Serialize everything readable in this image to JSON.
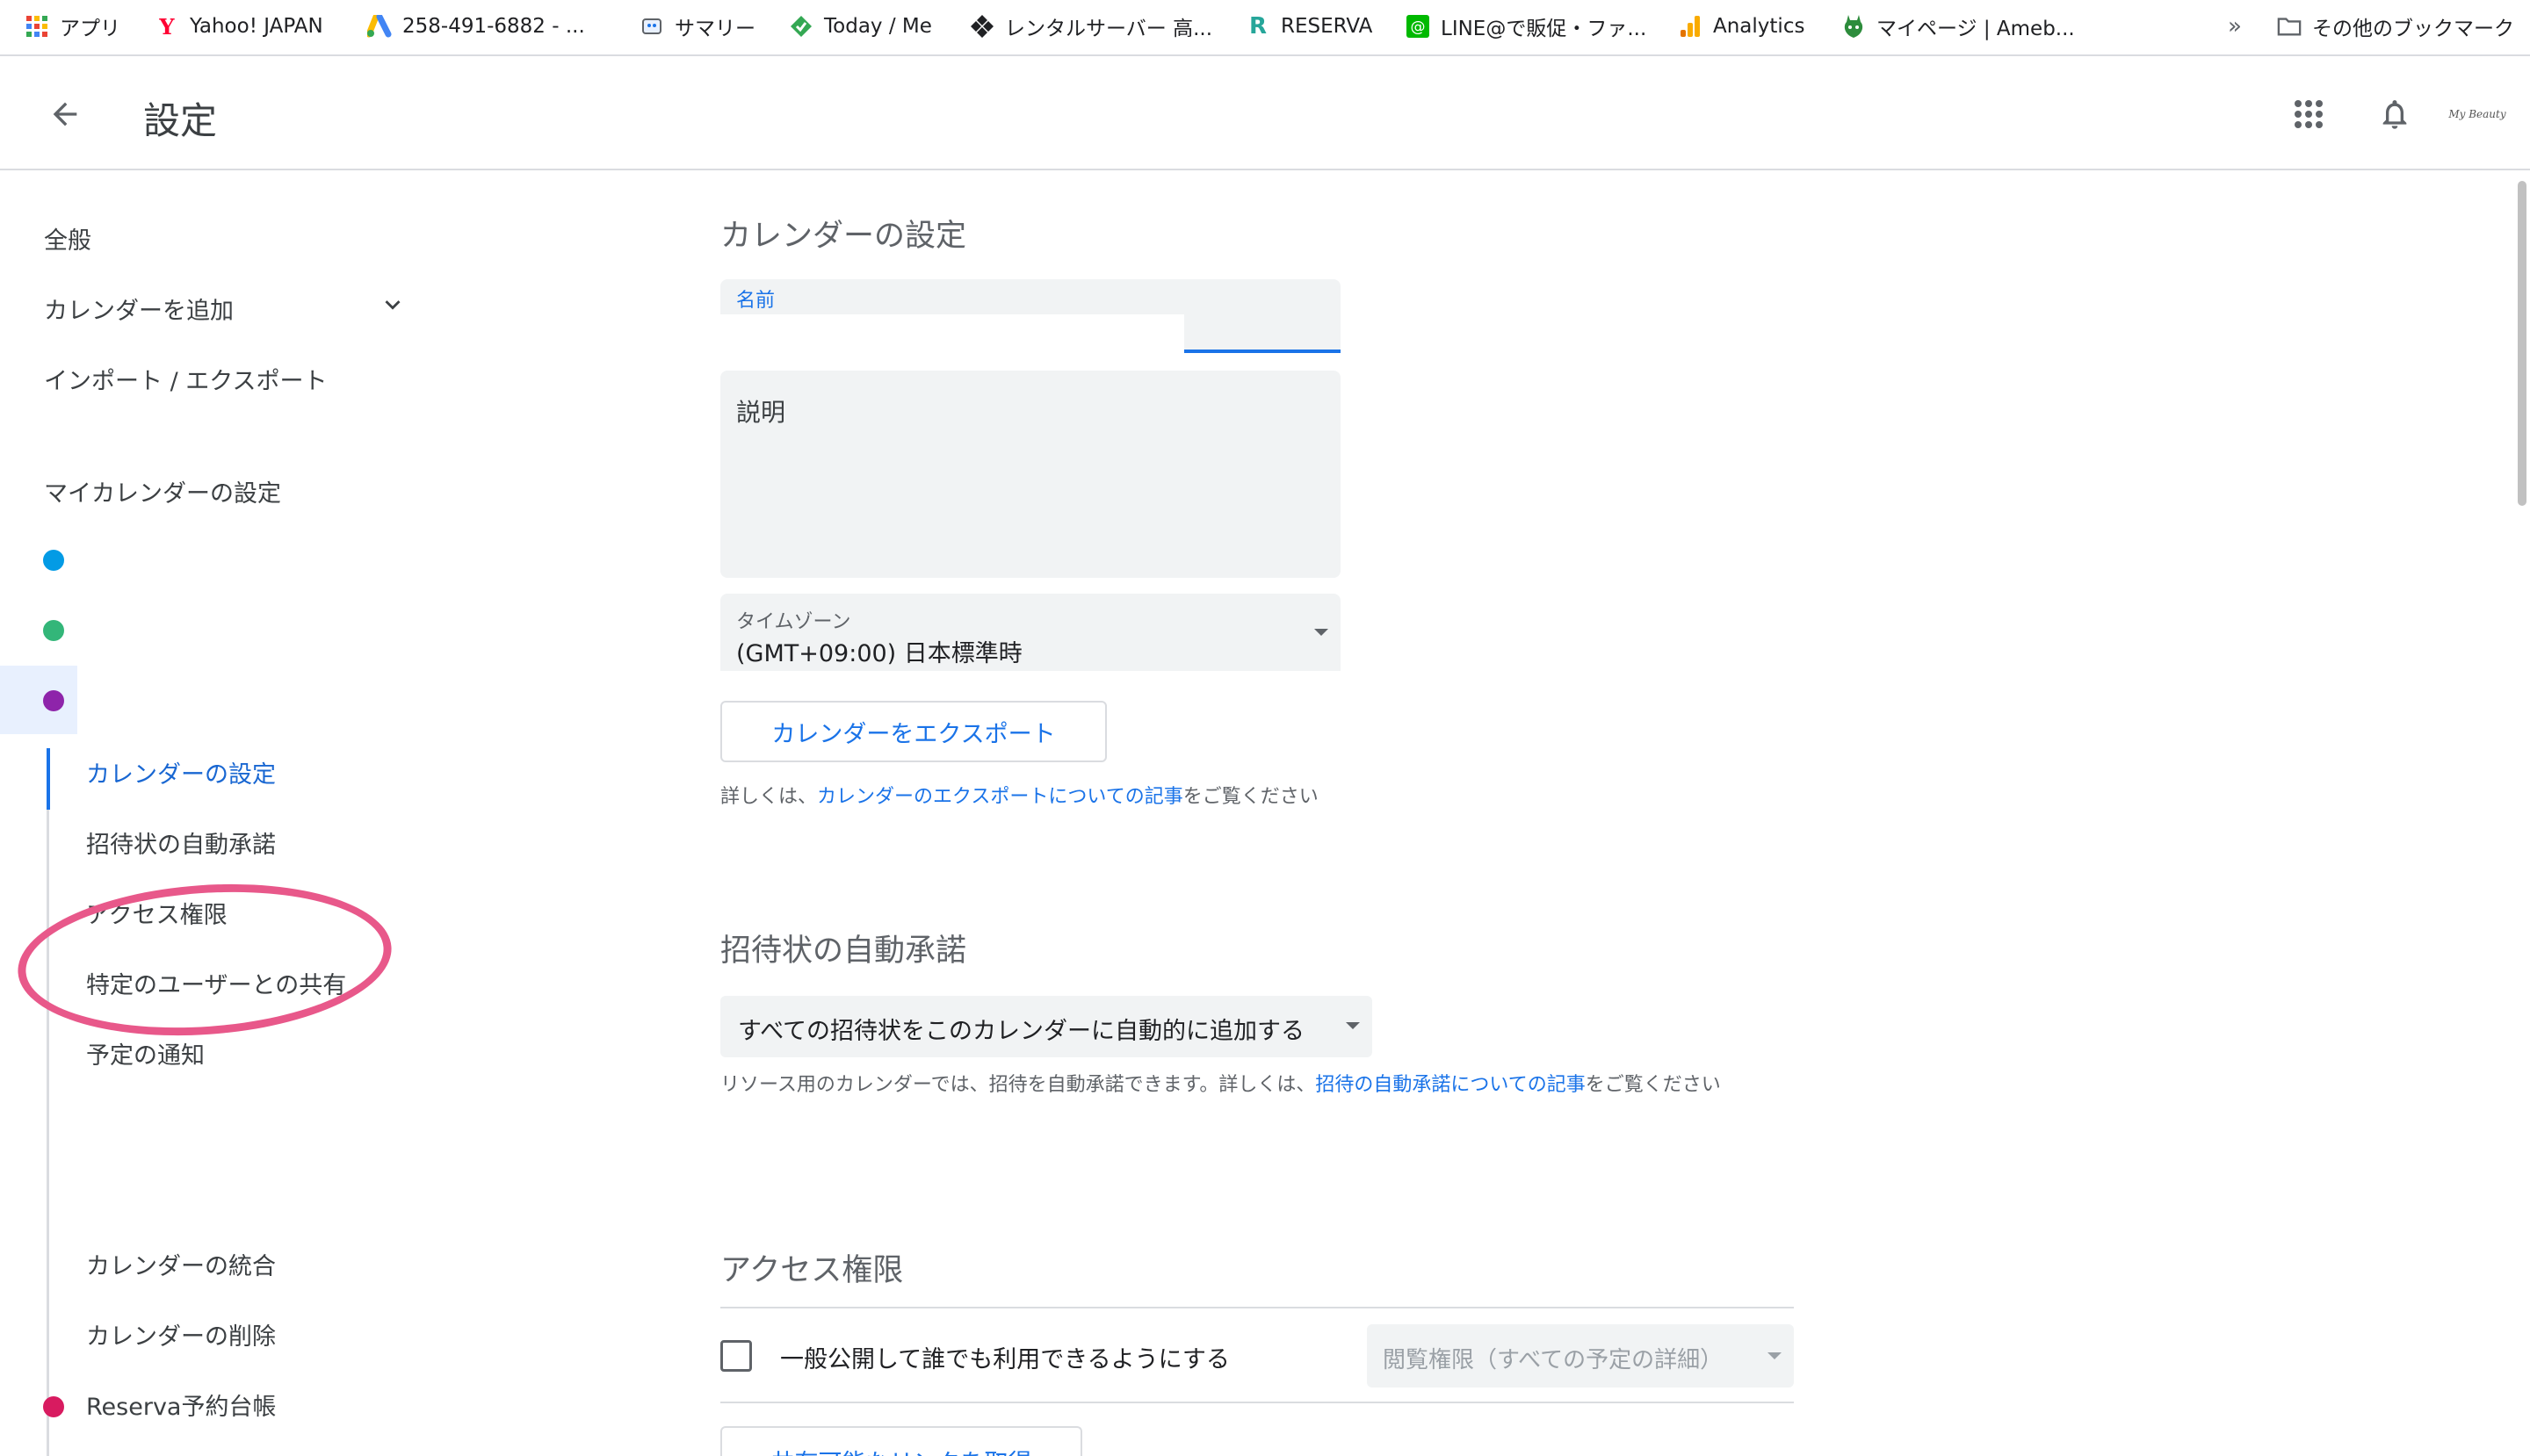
{
  "bookmarks": [
    {
      "label": "アプリ",
      "icon": "apps-grid-icon"
    },
    {
      "label": "Yahoo! JAPAN",
      "icon": "yahoo-icon"
    },
    {
      "label": "258-491-6882 - ...",
      "icon": "google-ads-icon"
    },
    {
      "label": "サマリー",
      "icon": "summary-icon"
    },
    {
      "label": "Today / Me",
      "icon": "today-icon"
    },
    {
      "label": "レンタルサーバー 高...",
      "icon": "rental-server-icon"
    },
    {
      "label": "RESERVA",
      "icon": "reserva-icon"
    },
    {
      "label": "LINE@で販促・ファ...",
      "icon": "line-icon"
    },
    {
      "label": "Analytics",
      "icon": "analytics-icon"
    },
    {
      "label": "マイページ | Ameb...",
      "icon": "ameba-icon"
    }
  ],
  "bookmarks_overflow": "»",
  "other_bookmarks": "その他のブックマーク",
  "header": {
    "title": "設定",
    "avatar_text": "My Beauty"
  },
  "sidebar": {
    "general": "全般",
    "add_calendar": "カレンダーを追加",
    "import_export": "インポート / エクスポート",
    "my_calendars_heading": "マイカレンダーの設定",
    "calendar_colors": [
      "#039be5",
      "#33b679",
      "#8e24aa"
    ],
    "sub_items": {
      "calendar_settings": "カレンダーの設定",
      "auto_accept": "招待状の自動承諾",
      "access": "アクセス権限",
      "share_users": "特定のユーザーとの共有",
      "event_notifications": "予定の通知",
      "general_notifications": "",
      "integrate": "カレンダーの統合",
      "delete": "カレンダーの削除"
    },
    "reserva_calendar": {
      "label": "Reserva予約台帳",
      "color": "#d81b60"
    }
  },
  "main": {
    "calendar_settings_title": "カレンダーの設定",
    "name_label": "名前",
    "name_value": "",
    "description_placeholder": "説明",
    "timezone_label": "タイムゾーン",
    "timezone_value": "(GMT+09:00) 日本標準時",
    "export_button": "カレンダーをエクスポート",
    "export_help_prefix": "詳しくは、",
    "export_help_link": "カレンダーのエクスポートについての記事",
    "export_help_suffix": "をご覧ください",
    "auto_accept_title": "招待状の自動承諾",
    "auto_accept_value": "すべての招待状をこのカレンダーに自動的に追加する",
    "auto_accept_help_prefix": "リソース用のカレンダーでは、招待を自動承諾できます。詳しくは、",
    "auto_accept_help_link": "招待の自動承諾についての記事",
    "auto_accept_help_suffix": "をご覧ください",
    "access_title": "アクセス権限",
    "public_checkbox_label": "一般公開して誰でも利用できるようにする",
    "public_checkbox_checked": false,
    "permission_value": "閲覧権限（すべての予定の詳細）",
    "shareable_link_button": "共有可能なリンクを取得"
  },
  "colors": {
    "accent": "#1a73e8",
    "annotation": "#e8588a"
  }
}
